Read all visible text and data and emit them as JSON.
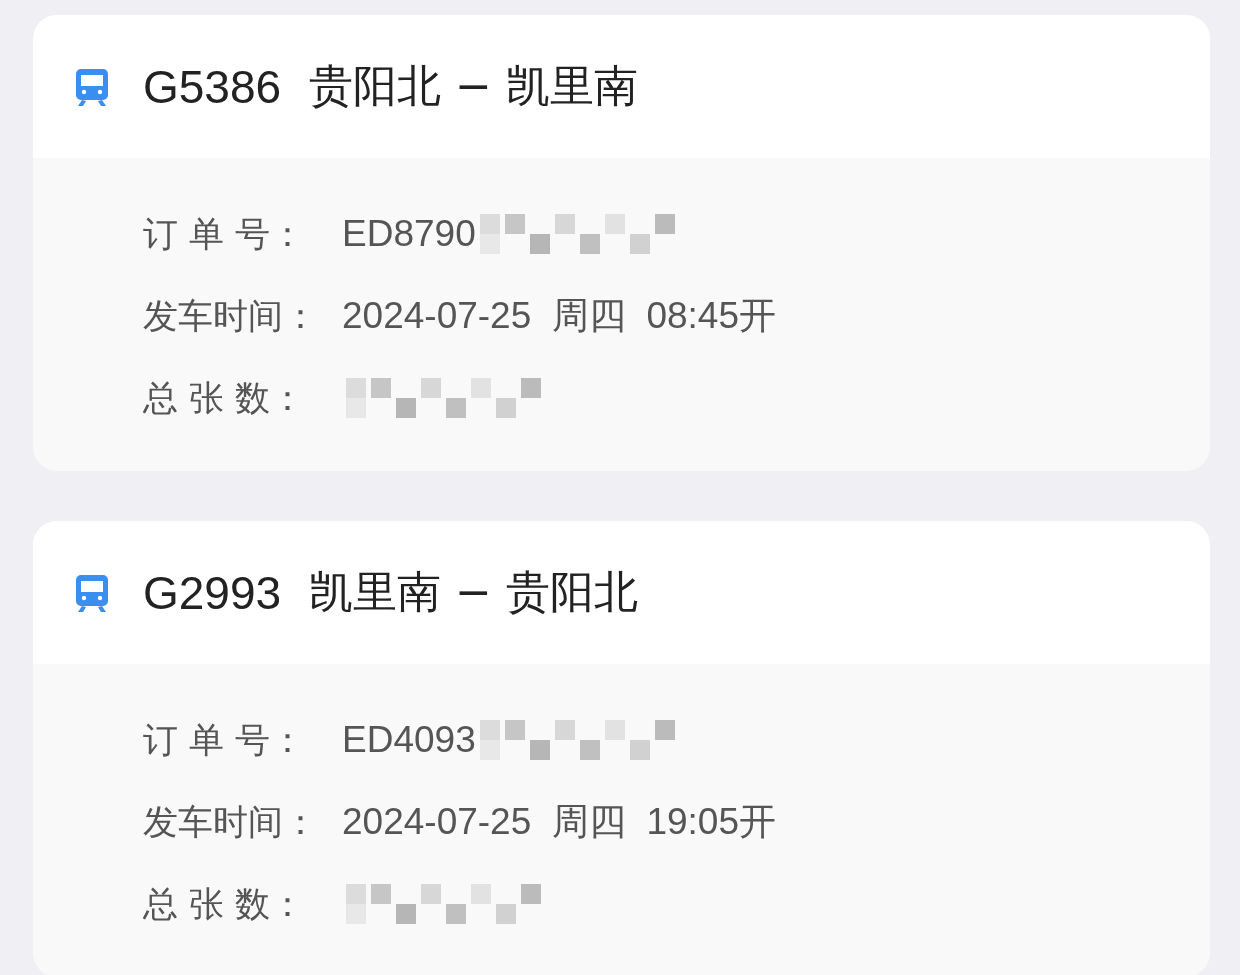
{
  "orders": [
    {
      "train": "G5386",
      "route": "贵阳北 − 凯里南",
      "fields": [
        {
          "label": "订 单 号：",
          "value": "ED8790",
          "redacted": true
        },
        {
          "label": "发车时间：",
          "value": "2024-07-25  周四  08:45开",
          "redacted": false
        },
        {
          "label": "总 张 数：",
          "redacted": true
        }
      ]
    },
    {
      "train": "G2993",
      "route": "凯里南 − 贵阳北",
      "fields": [
        {
          "label": "订 单 号：",
          "value": "ED4093",
          "redacted": true
        },
        {
          "label": "发车时间：",
          "value": "2024-07-25  周四  19:05开",
          "redacted": false
        },
        {
          "label": "总 张 数：",
          "redacted": true
        }
      ]
    }
  ]
}
